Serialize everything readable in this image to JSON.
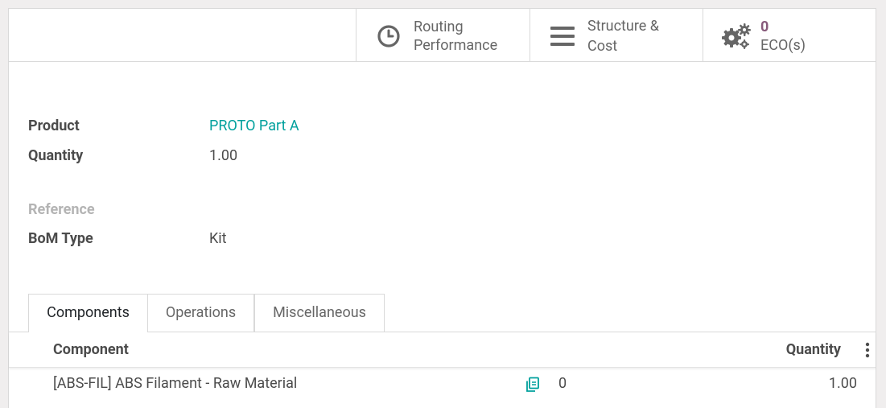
{
  "smart_buttons": {
    "routing": {
      "line1": "Routing",
      "line2": "Performance",
      "icon": "clock-icon"
    },
    "structure": {
      "line1": "Structure &",
      "line2": "Cost",
      "icon": "bars-icon"
    },
    "eco": {
      "count": "0",
      "label": "ECO(s)",
      "icon": "gears-icon"
    }
  },
  "form": {
    "product": {
      "label": "Product",
      "value": "PROTO Part A"
    },
    "quantity": {
      "label": "Quantity",
      "value": "1.00"
    },
    "reference": {
      "label": "Reference",
      "value": ""
    },
    "bom_type": {
      "label": "BoM Type",
      "value": "Kit"
    }
  },
  "tabs": [
    {
      "label": "Components",
      "active": true
    },
    {
      "label": "Operations",
      "active": false
    },
    {
      "label": "Miscellaneous",
      "active": false
    }
  ],
  "components_table": {
    "columns": {
      "component": "Component",
      "quantity": "Quantity"
    },
    "rows": [
      {
        "component": "[ABS-FIL] ABS Filament - Raw Material",
        "available": "0",
        "quantity": "1.00"
      }
    ]
  },
  "colors": {
    "link": "#00a09d",
    "brand": "#875a7b",
    "text": "#4c4c4c",
    "muted": "#b4b4b4"
  }
}
